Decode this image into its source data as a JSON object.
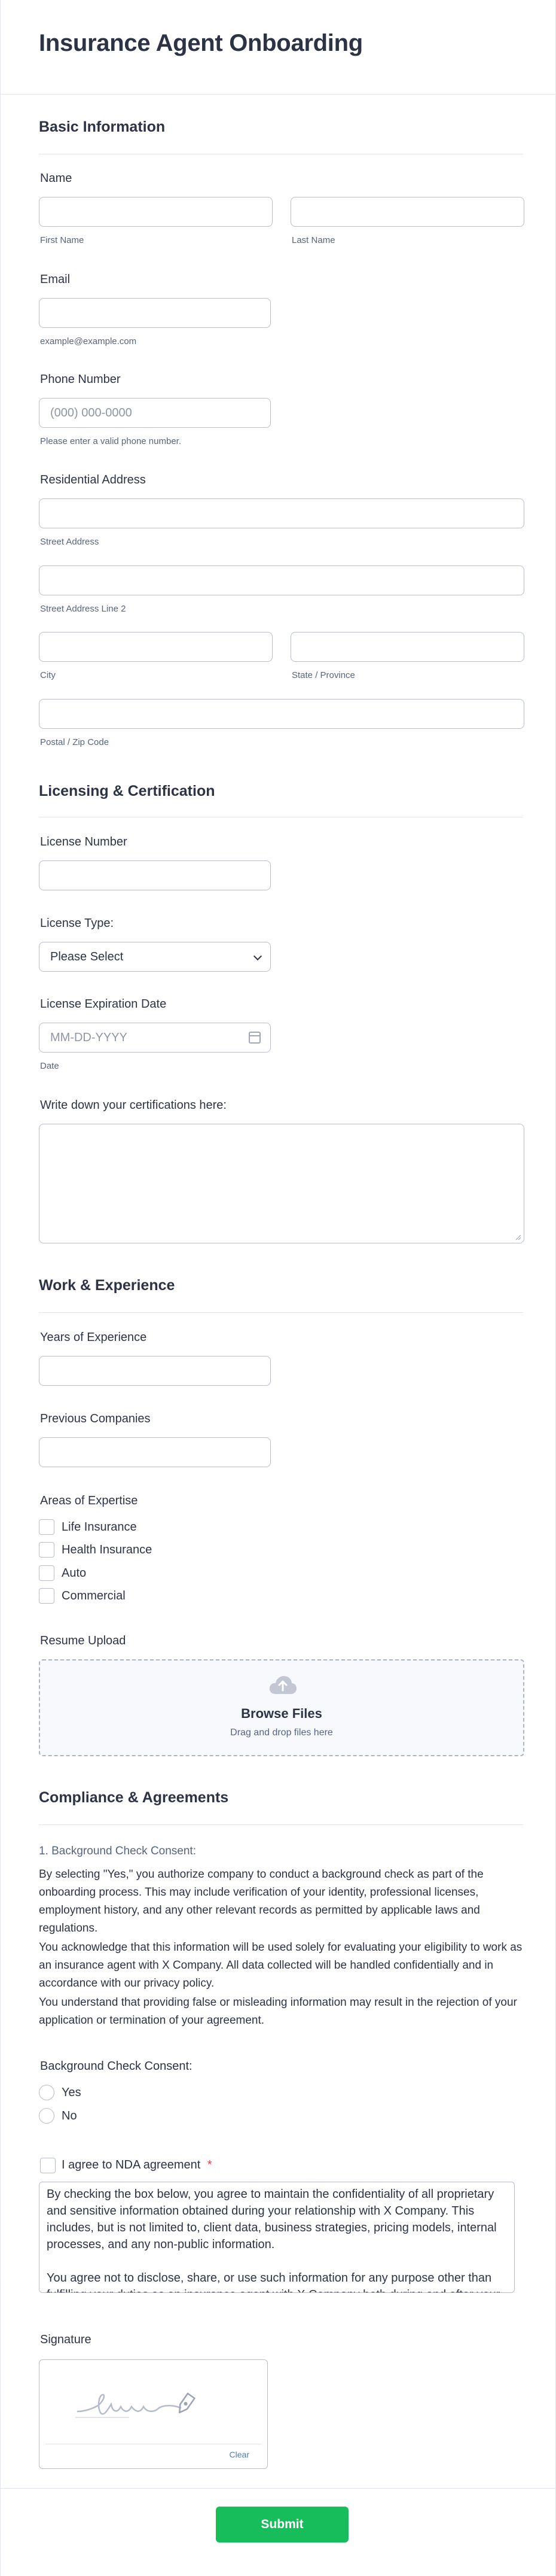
{
  "form": {
    "title": "Insurance Agent Onboarding",
    "submit_label": "Submit"
  },
  "basic": {
    "heading": "Basic Information",
    "name_label": "Name",
    "first_name": "First Name",
    "last_name": "Last Name",
    "email_label": "Email",
    "email_hint": "example@example.com",
    "phone_label": "Phone Number",
    "phone_placeholder": "(000) 000-0000",
    "phone_hint": "Please enter a valid phone number.",
    "address_label": "Residential Address",
    "street": "Street Address",
    "street2": "Street Address Line 2",
    "city": "City",
    "state": "State / Province",
    "postal": "Postal / Zip Code"
  },
  "licensing": {
    "heading": "Licensing & Certification",
    "license_number_label": "License Number",
    "license_type_label": "License Type:",
    "license_type_value": "Please Select",
    "expiration_label": "License Expiration Date",
    "expiration_placeholder": "MM-DD-YYYY",
    "date_sublabel": "Date",
    "certifications_label": "Write down your certifications here:"
  },
  "work": {
    "heading": "Work & Experience",
    "years_label": "Years of Experience",
    "companies_label": "Previous Companies",
    "expertise_label": "Areas of Expertise",
    "expertise_options": [
      "Life Insurance",
      "Health Insurance",
      "Auto",
      "Commercial"
    ],
    "resume_label": "Resume Upload",
    "browse_label": "Browse Files",
    "drag_label": "Drag and drop files here"
  },
  "compliance": {
    "heading": "Compliance & Agreements",
    "consent_title": "1. Background Check Consent:",
    "para1": "By selecting \"Yes,\" you authorize company to conduct a background check as part of the onboarding process. This may include verification of your identity, professional licenses, employment history, and any other relevant records as permitted by applicable laws and regulations.",
    "para2": "You acknowledge that this information will be used solely for evaluating your eligibility to work as an insurance agent with X Company. All data collected will be handled confidentially and in accordance with our privacy policy.",
    "para3": "You understand that providing false or misleading information may result in the rejection of your application or termination of your agreement.",
    "radio_label": "Background Check Consent:",
    "radio_options": [
      "Yes",
      "No"
    ],
    "nda_label": "I agree to NDA agreement",
    "required_mark": "*",
    "nda_text": "By checking the box below, you agree to maintain the confidentiality of all proprietary and sensitive information obtained during your relationship with X Company. This includes, but is not limited to, client data, business strategies, pricing models, internal processes, and any non-public information.\n\nYou agree not to disclose, share, or use such information for any purpose other than fulfilling your duties as an insurance agent with X Company both during and after your engagement.",
    "signature_label": "Signature",
    "clear_label": "Clear"
  },
  "colors": {
    "accent_submit": "#18bd5b",
    "required": "#f23a3c",
    "link_blue": "#4e7bbd"
  }
}
